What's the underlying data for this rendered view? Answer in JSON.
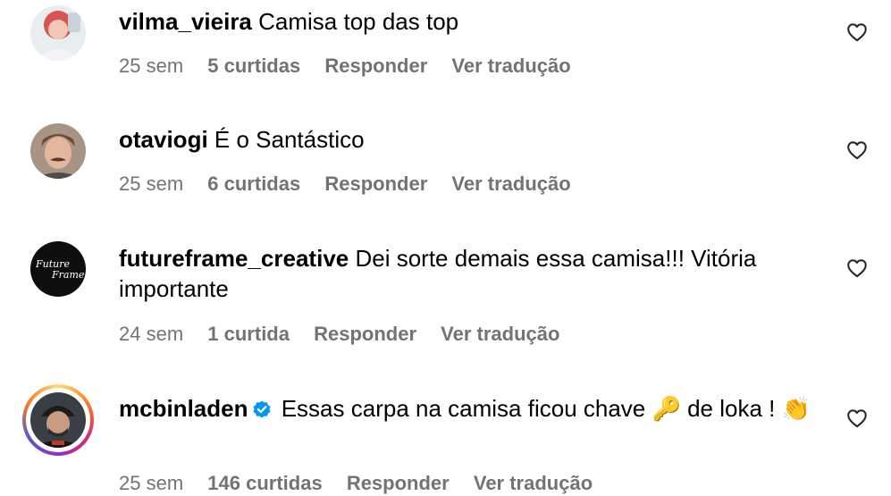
{
  "comments": [
    {
      "username": "vilma_vieira",
      "text": "Camisa top das top",
      "time": "25 sem",
      "likes": "5 curtidas",
      "reply_label": "Responder",
      "translate_label": "Ver tradução",
      "avatar": "woman-red-hair-avatar"
    },
    {
      "username": "otaviogi",
      "text": "É o Santástico",
      "time": "25 sem",
      "likes": "6 curtidas",
      "reply_label": "Responder",
      "translate_label": "Ver tradução",
      "avatar": "man-mustache-avatar"
    },
    {
      "username": "futureframe_creative",
      "text": "Dei sorte demais essa camisa!!! Vitória importante",
      "time": "24 sem",
      "likes": "1 curtida",
      "reply_label": "Responder",
      "translate_label": "Ver tradução",
      "avatar": "future-frame-logo",
      "avatar_lettering": "Future Frame"
    },
    {
      "username": "mcbinladen",
      "verified": true,
      "text": "Essas carpa na camisa ficou chave 🔑 de loka ! 👏",
      "time": "25 sem",
      "likes": "146 curtidas",
      "reply_label": "Responder",
      "translate_label": "Ver tradução",
      "avatar": "man-cap-avatar",
      "has_story": true
    }
  ],
  "colors": {
    "meta_text": "#737373",
    "verified_badge": "#0095f6",
    "story_ring": [
      "#feda75",
      "#fa7e1e",
      "#d62976",
      "#962fbf",
      "#4f5bd5"
    ]
  },
  "icons": {
    "like": "heart-outline-icon",
    "verified": "verified-badge-icon"
  }
}
